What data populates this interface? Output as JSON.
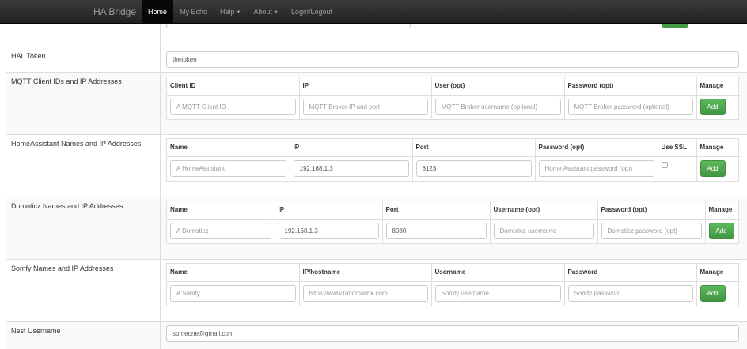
{
  "navbar": {
    "brand": "HA Bridge",
    "items": [
      {
        "label": "Home",
        "active": true
      },
      {
        "label": "My Echo"
      },
      {
        "label": "Help",
        "dropdown": true
      },
      {
        "label": "About",
        "dropdown": true
      },
      {
        "label": "Login/Logout"
      }
    ]
  },
  "hal": {
    "label": "HAL Token",
    "value": "thetoken"
  },
  "mqtt": {
    "label": "MQTT Client IDs and IP Addresses",
    "headers": [
      "Client ID",
      "IP",
      "User (opt)",
      "Password (opt)",
      "Manage"
    ],
    "placeholders": [
      "A MQTT Client ID",
      "MQTT Broker IP and port",
      "MQTT Broker username (optional)",
      "MQTT Broker password (optional)"
    ],
    "add": "Add"
  },
  "homeassistant": {
    "label": "HomeAssistant Names and IP Addresses",
    "headers": [
      "Name",
      "IP",
      "Port",
      "Password (opt)",
      "Use SSL",
      "Manage"
    ],
    "values": [
      "A HomeAssistant",
      "192.168.1.3",
      "8123",
      "Home Assistant password (opt)"
    ],
    "add": "Add"
  },
  "domoticz": {
    "label": "Domoticz Names and IP Addresses",
    "headers": [
      "Name",
      "IP",
      "Port",
      "Username (opt)",
      "Password (opt)",
      "Manage"
    ],
    "values": [
      "A Domoticz",
      "192.168.1.3",
      "8080",
      "Domoticz username",
      "Domoticz password (opt)"
    ],
    "add": "Add"
  },
  "somfy": {
    "label": "Somfy Names and IP Addresses",
    "headers": [
      "Name",
      "IP/hostname",
      "Username",
      "Password",
      "Manage"
    ],
    "values": [
      "A Somfy",
      "https://www.tahomalink.com",
      "Somfy username",
      "Somfy password"
    ],
    "add": "Add"
  },
  "nest": {
    "label": "Nest Username",
    "value": "someone@gmail.com"
  }
}
